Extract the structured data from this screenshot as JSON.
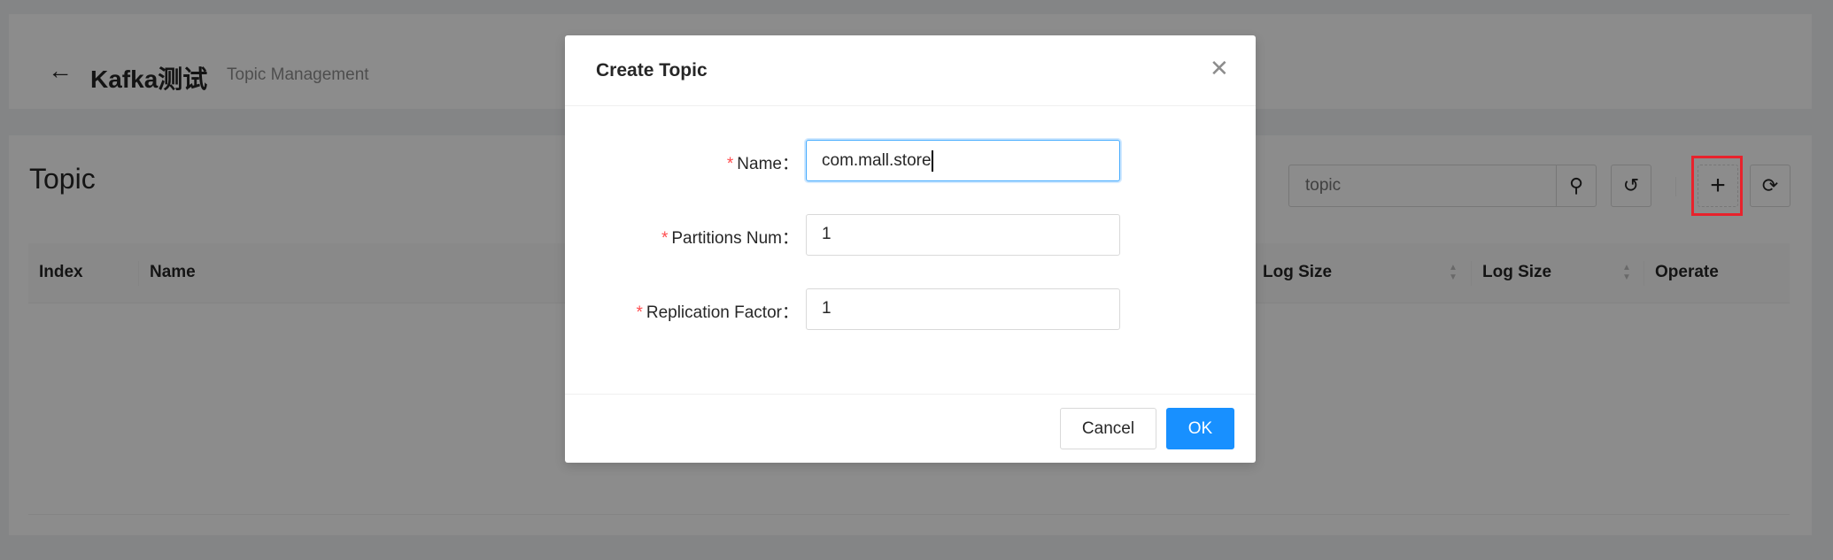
{
  "header": {
    "title": "Kafka测试",
    "subtitle": "Topic Management"
  },
  "main": {
    "heading": "Topic",
    "search_placeholder": "topic",
    "columns": [
      "Index",
      "Name",
      "Log Size",
      "Log Size",
      "Operate"
    ]
  },
  "modal": {
    "title": "Create Topic",
    "fields": [
      {
        "label": "Name",
        "value": "com.mall.store"
      },
      {
        "label": "Partitions Num",
        "value": "1"
      },
      {
        "label": "Replication Factor",
        "value": "1"
      }
    ],
    "cancel": "Cancel",
    "ok": "OK"
  },
  "colors": {
    "primary": "#1890ff",
    "required": "#ff4d4f",
    "highlight": "#e8222c"
  }
}
